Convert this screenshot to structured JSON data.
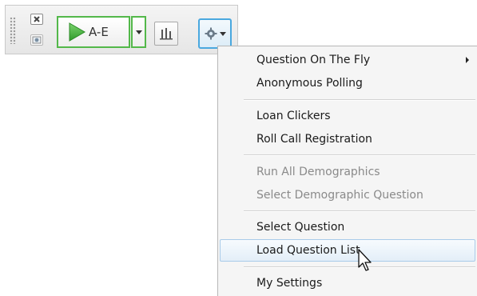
{
  "toolbar": {
    "start_button_label": "A-E",
    "icons": {
      "close": "close-icon",
      "image": "image-icon",
      "play": "play-icon",
      "dropdown": "chevron-down-icon",
      "chart": "bar-chart-icon",
      "gear": "gear-icon"
    },
    "colors": {
      "start_border": "#53b84a",
      "gear_border": "#4aa8df"
    }
  },
  "menu": {
    "items": [
      {
        "label": "Question On The Fly",
        "enabled": true,
        "has_submenu": true
      },
      {
        "label": "Anonymous Polling",
        "enabled": true
      },
      {
        "label": "Loan Clickers",
        "enabled": true
      },
      {
        "label": "Roll Call Registration",
        "enabled": true
      },
      {
        "label": "Run All Demographics",
        "enabled": false
      },
      {
        "label": "Select Demographic Question",
        "enabled": false
      },
      {
        "label": "Select Question",
        "enabled": true
      },
      {
        "label": "Load Question List",
        "enabled": true,
        "hovered": true
      },
      {
        "label": "My Settings",
        "enabled": true
      }
    ]
  }
}
